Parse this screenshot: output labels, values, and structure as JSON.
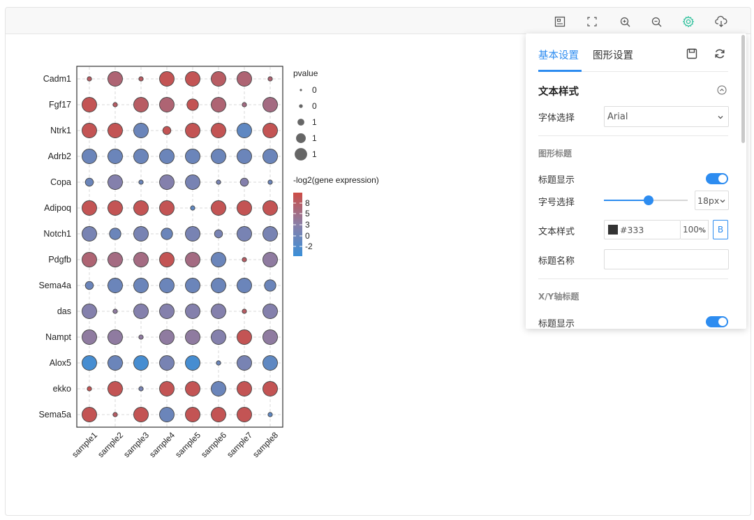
{
  "toolbar": {
    "icons": [
      "layout-icon",
      "fullscreen-icon",
      "zoom-in-icon",
      "zoom-out-icon",
      "settings-icon",
      "download-icon"
    ]
  },
  "chart_data": {
    "type": "scatter",
    "subtype": "dot-plot",
    "genes": [
      "Cadm1",
      "Fgf17",
      "Ntrk1",
      "Adrb2",
      "Copa",
      "Adipoq",
      "Notch1",
      "Pdgfb",
      "Sema4a",
      "das",
      "Nampt",
      "Alox5",
      "ekko",
      "Sema5a"
    ],
    "samples": [
      "sample1",
      "sample2",
      "sample3",
      "sample4",
      "sample5",
      "sample6",
      "sample7",
      "sample8"
    ],
    "size_levels": [
      0.06,
      0.3,
      0.55,
      0.78,
      1.0
    ],
    "color_scale": {
      "min": -3,
      "max": 10,
      "low_color": "#3a8fd8",
      "mid_color": "#8a7fa8",
      "high_color": "#cd4c45"
    },
    "size": [
      [
        1,
        4,
        1,
        4,
        4,
        4,
        4,
        1
      ],
      [
        4,
        1,
        4,
        4,
        3,
        4,
        1,
        4
      ],
      [
        4,
        4,
        4,
        2,
        4,
        4,
        4,
        4
      ],
      [
        4,
        4,
        4,
        4,
        4,
        4,
        4,
        4
      ],
      [
        2,
        4,
        1,
        4,
        4,
        1,
        2,
        1
      ],
      [
        4,
        4,
        4,
        4,
        1,
        4,
        4,
        4
      ],
      [
        4,
        3,
        4,
        3,
        4,
        2,
        4,
        4
      ],
      [
        4,
        4,
        4,
        4,
        4,
        4,
        1,
        4
      ],
      [
        2,
        4,
        4,
        4,
        4,
        4,
        4,
        3
      ],
      [
        4,
        1,
        4,
        4,
        4,
        4,
        1,
        4
      ],
      [
        4,
        4,
        1,
        4,
        4,
        4,
        4,
        4
      ],
      [
        4,
        4,
        4,
        4,
        4,
        1,
        4,
        4
      ],
      [
        1,
        4,
        1,
        4,
        4,
        4,
        4,
        4
      ],
      [
        4,
        1,
        4,
        4,
        4,
        4,
        4,
        1
      ]
    ],
    "color": [
      [
        8,
        7,
        8,
        9,
        9,
        8,
        7,
        7
      ],
      [
        9,
        8,
        8,
        7,
        9,
        7,
        6,
        6
      ],
      [
        9,
        9,
        1,
        9,
        9,
        9,
        0,
        9
      ],
      [
        1,
        1,
        1,
        1,
        1,
        1,
        1,
        1
      ],
      [
        1,
        3,
        1,
        3,
        2,
        2,
        3,
        1
      ],
      [
        9,
        9,
        9,
        9,
        0,
        9,
        9,
        9
      ],
      [
        2,
        1,
        2,
        1,
        2,
        2,
        2,
        2
      ],
      [
        7,
        6,
        6,
        9,
        6,
        1,
        8,
        4
      ],
      [
        1,
        1,
        1,
        1,
        1,
        1,
        1,
        1
      ],
      [
        3,
        4,
        3,
        3,
        3,
        3,
        8,
        3
      ],
      [
        4,
        4,
        4,
        4,
        4,
        3,
        9,
        4
      ],
      [
        -2,
        1,
        -2,
        2,
        -2,
        1,
        2,
        0
      ],
      [
        9,
        9,
        2,
        9,
        9,
        1,
        9,
        9
      ],
      [
        9,
        8,
        9,
        1,
        9,
        9,
        9,
        0
      ]
    ],
    "legend_size": {
      "title": "pvalue",
      "labels": [
        "0",
        "0",
        "1",
        "1",
        "1"
      ]
    },
    "legend_color": {
      "title": "-log2(gene expression)",
      "labels": [
        "8",
        "5",
        "3",
        "0",
        "-2"
      ]
    },
    "grid": true
  },
  "panel": {
    "tabs": [
      "基本设置",
      "图形设置"
    ],
    "active_tab": 0,
    "sections": {
      "text_style": "文本样式",
      "font_label": "字体选择",
      "font_value": "Arial",
      "chart_title_header": "图形标题",
      "title_show_label": "标题显示",
      "font_size_label": "字号选择",
      "font_size_value": "18px",
      "font_size_fraction": 0.53,
      "text_style_label": "文本样式",
      "color_value": "#333",
      "opacity_value": "100",
      "opacity_unit": "%",
      "bold_label": "B",
      "title_name_label": "标题名称",
      "title_name_value": "",
      "axis_title_header": "X/Y轴标题",
      "axis_title_show_label": "标题显示"
    },
    "colors": {
      "accent": "#2d8cf0"
    }
  }
}
